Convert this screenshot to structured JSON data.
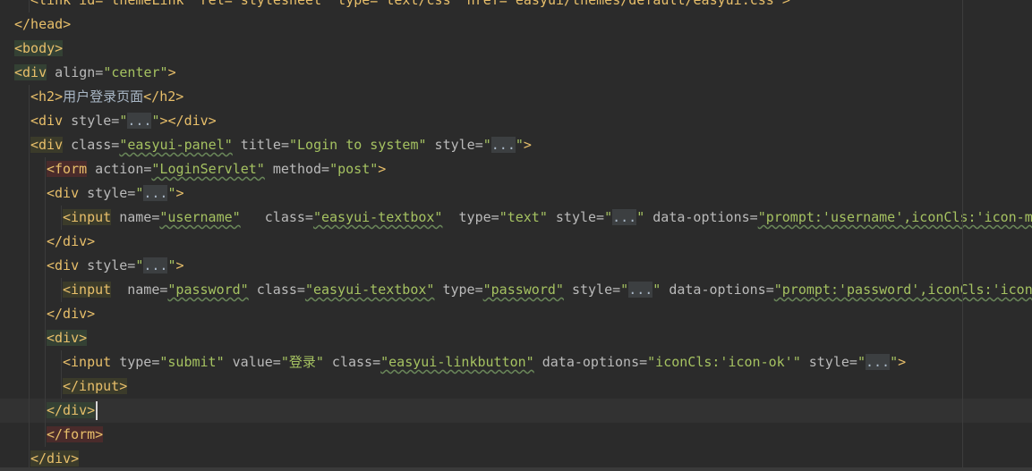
{
  "editor": {
    "language": "HTML",
    "colors": {
      "background": "#2b2b2b",
      "tag": "#e8bf6a",
      "attribute": "#bababa",
      "value": "#a5c261",
      "text": "#a9b7c6",
      "current_line": "#323232"
    },
    "lines": [
      {
        "indent": 1,
        "tokens": [
          {
            "t": "<link id=\"themeLink\" rel=\"stylesheet\" type=\"text/css\" href=\"easyui/themes/default/easyui.css\">",
            "c": "tg"
          }
        ]
      },
      {
        "indent": 0,
        "tokens": [
          {
            "t": "</head>",
            "c": "tg"
          }
        ]
      },
      {
        "indent": 0,
        "tokens": [
          {
            "t": "<body>",
            "c": "tg hlg"
          }
        ]
      },
      {
        "indent": 0,
        "tokens": [
          {
            "t": "<div",
            "c": "tg hlg"
          },
          {
            "t": " align=",
            "c": "at"
          },
          {
            "t": "\"center\"",
            "c": "vl"
          },
          {
            "t": ">",
            "c": "tg"
          }
        ]
      },
      {
        "indent": 1,
        "tokens": [
          {
            "t": "<h2>",
            "c": "tg"
          },
          {
            "t": "用户登录页面",
            "c": ""
          },
          {
            "t": "</h2>",
            "c": "tg"
          }
        ]
      },
      {
        "indent": 1,
        "tokens": [
          {
            "t": "<div",
            "c": "tg"
          },
          {
            "t": " style=",
            "c": "at"
          },
          {
            "t": "\"",
            "c": "vl"
          },
          {
            "t": "...",
            "c": "fold"
          },
          {
            "t": "\"",
            "c": "vl"
          },
          {
            "t": "></div>",
            "c": "tg"
          }
        ]
      },
      {
        "indent": 1,
        "tokens": [
          {
            "t": "<div",
            "c": "tg hly"
          },
          {
            "t": " class=",
            "c": "at"
          },
          {
            "t": "\"easyui-panel\"",
            "c": "vl"
          },
          {
            "t": " title=",
            "c": "at"
          },
          {
            "t": "\"Login to system\"",
            "c": "vl"
          },
          {
            "t": " style=",
            "c": "at"
          },
          {
            "t": "\"",
            "c": "vl"
          },
          {
            "t": "...",
            "c": "fold"
          },
          {
            "t": "\"",
            "c": "vl"
          },
          {
            "t": ">",
            "c": "tg"
          }
        ]
      },
      {
        "indent": 2,
        "tokens": [
          {
            "t": "<form",
            "c": "tg hlr"
          },
          {
            "t": " action=",
            "c": "at"
          },
          {
            "t": "\"LoginServlet\"",
            "c": "vl"
          },
          {
            "t": " method=",
            "c": "at"
          },
          {
            "t": "\"post\"",
            "c": "vl"
          },
          {
            "t": ">",
            "c": "tg"
          }
        ]
      },
      {
        "indent": 2,
        "tokens": [
          {
            "t": "<div",
            "c": "tg"
          },
          {
            "t": " style=",
            "c": "at"
          },
          {
            "t": "\"",
            "c": "vl"
          },
          {
            "t": "...",
            "c": "fold"
          },
          {
            "t": "\"",
            "c": "vl"
          },
          {
            "t": ">",
            "c": "tg"
          }
        ]
      },
      {
        "indent": 3,
        "tokens": [
          {
            "t": "<input",
            "c": "tg hly"
          },
          {
            "t": " name=",
            "c": "at"
          },
          {
            "t": "\"username\"",
            "c": "vl"
          },
          {
            "t": "   class=",
            "c": "at"
          },
          {
            "t": "\"easyui-textbox\"",
            "c": "vl"
          },
          {
            "t": "  type=",
            "c": "at"
          },
          {
            "t": "\"text\"",
            "c": "vl"
          },
          {
            "t": " style=",
            "c": "at"
          },
          {
            "t": "\"",
            "c": "vl"
          },
          {
            "t": "...",
            "c": "fold"
          },
          {
            "t": "\"",
            "c": "vl"
          },
          {
            "t": " data-options=",
            "c": "at"
          },
          {
            "t": "\"prompt:'username',iconCls:'icon-man'\"",
            "c": "vl"
          }
        ]
      },
      {
        "indent": 2,
        "tokens": [
          {
            "t": "</div>",
            "c": "tg"
          }
        ]
      },
      {
        "indent": 2,
        "tokens": [
          {
            "t": "<div",
            "c": "tg"
          },
          {
            "t": " style=",
            "c": "at"
          },
          {
            "t": "\"",
            "c": "vl"
          },
          {
            "t": "...",
            "c": "fold"
          },
          {
            "t": "\"",
            "c": "vl"
          },
          {
            "t": ">",
            "c": "tg"
          }
        ]
      },
      {
        "indent": 3,
        "tokens": [
          {
            "t": "<input",
            "c": "tg hly"
          },
          {
            "t": "  name=",
            "c": "at"
          },
          {
            "t": "\"password\"",
            "c": "vl"
          },
          {
            "t": " class=",
            "c": "at"
          },
          {
            "t": "\"easyui-textbox\"",
            "c": "vl"
          },
          {
            "t": " type=",
            "c": "at"
          },
          {
            "t": "\"password\"",
            "c": "vl"
          },
          {
            "t": " style=",
            "c": "at"
          },
          {
            "t": "\"",
            "c": "vl"
          },
          {
            "t": "...",
            "c": "fold"
          },
          {
            "t": "\"",
            "c": "vl"
          },
          {
            "t": " data-options=",
            "c": "at"
          },
          {
            "t": "\"prompt:'password',iconCls:'icon-lock'\"",
            "c": "vl"
          }
        ]
      },
      {
        "indent": 2,
        "tokens": [
          {
            "t": "</div>",
            "c": "tg"
          }
        ]
      },
      {
        "indent": 2,
        "tokens": [
          {
            "t": "<div>",
            "c": "tg hlg"
          }
        ]
      },
      {
        "indent": 3,
        "tokens": [
          {
            "t": "<input",
            "c": "tg"
          },
          {
            "t": " type=",
            "c": "at"
          },
          {
            "t": "\"submit\"",
            "c": "vl"
          },
          {
            "t": " value=",
            "c": "at"
          },
          {
            "t": "\"登录\"",
            "c": "vl"
          },
          {
            "t": " class=",
            "c": "at"
          },
          {
            "t": "\"easyui-linkbutton\"",
            "c": "vl"
          },
          {
            "t": " data-options=",
            "c": "at"
          },
          {
            "t": "\"iconCls:'icon-ok'\"",
            "c": "vl"
          },
          {
            "t": " style=",
            "c": "at"
          },
          {
            "t": "\"",
            "c": "vl"
          },
          {
            "t": "...",
            "c": "fold"
          },
          {
            "t": "\"",
            "c": "vl"
          },
          {
            "t": ">",
            "c": "tg"
          }
        ]
      },
      {
        "indent": 3,
        "tokens": [
          {
            "t": "</input>",
            "c": "tg hly"
          }
        ]
      },
      {
        "indent": 2,
        "current": true,
        "caret": true,
        "tokens": [
          {
            "t": "</div>",
            "c": "tg hlg"
          }
        ]
      },
      {
        "indent": 2,
        "tokens": [
          {
            "t": "</form>",
            "c": "tg hlr"
          }
        ]
      },
      {
        "indent": 1,
        "tokens": [
          {
            "t": "</div>",
            "c": "tg hly"
          }
        ]
      }
    ]
  }
}
